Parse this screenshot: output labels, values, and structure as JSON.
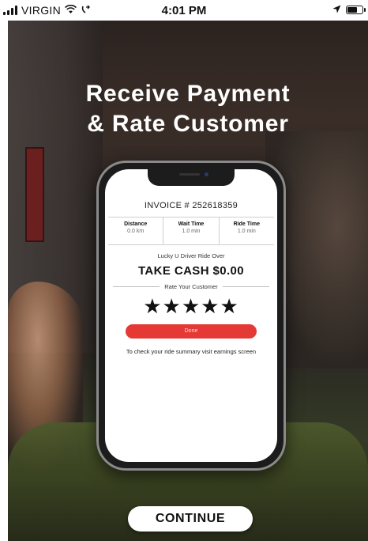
{
  "status_bar": {
    "carrier": "VIRGIN",
    "time": "4:01 PM",
    "wifi_icon": "wifi-icon",
    "call_forward_icon": "call-forward-icon",
    "location_icon": "location-arrow-icon",
    "battery_icon": "battery-icon"
  },
  "headline": {
    "line1": "Receive Payment",
    "line2": "& Rate Customer"
  },
  "invoice": {
    "title": "INVOICE # 252618359",
    "metrics": [
      {
        "label": "Distance",
        "value": "0.0 km"
      },
      {
        "label": "Wait Time",
        "value": "1.0 min"
      },
      {
        "label": "Ride Time",
        "value": "1.0 min"
      }
    ],
    "ride_over_text": "Lucky U Driver Ride Over",
    "take_cash": "TAKE CASH $0.00",
    "rate_label": "Rate Your Customer",
    "stars": "★★★★★",
    "done_label": "Done",
    "summary_note": "To check your ride summary visit earnings screen"
  },
  "continue_label": "CONTINUE",
  "colors": {
    "done_button": "#e53935",
    "text_dark": "#111111",
    "headline": "#ffffff"
  }
}
